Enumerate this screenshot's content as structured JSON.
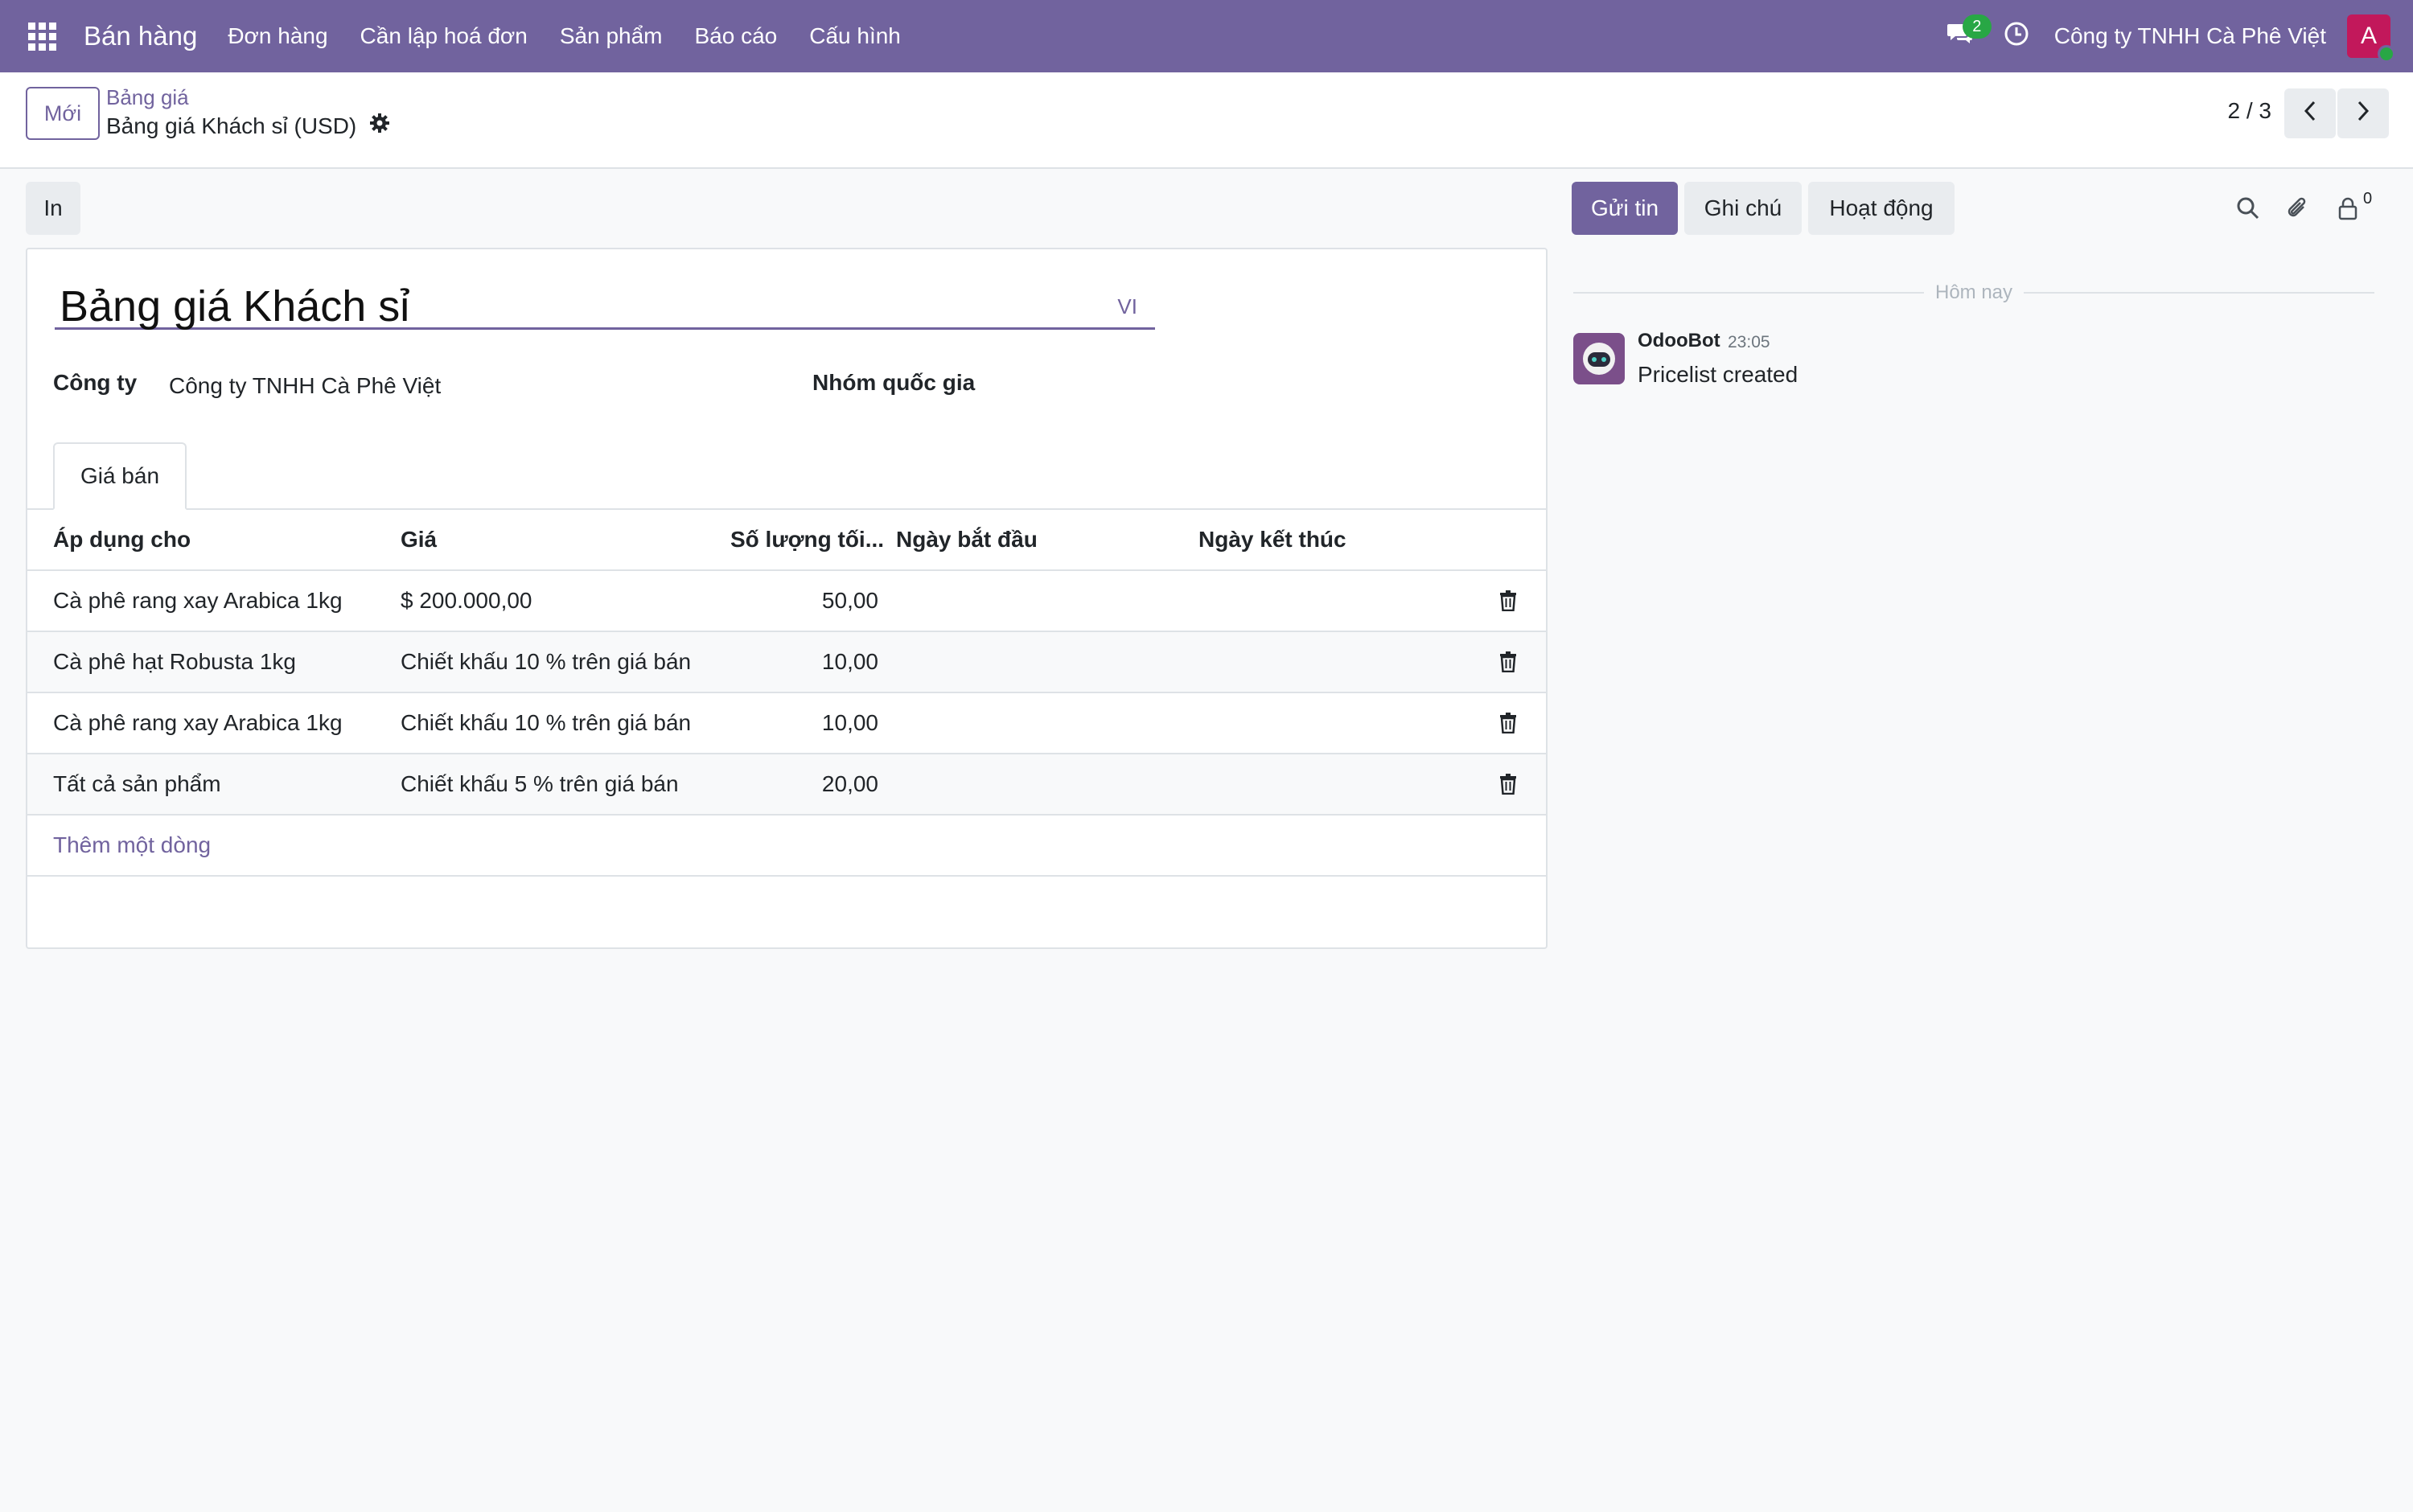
{
  "navbar": {
    "app_name": "Bán hàng",
    "menu": [
      "Đơn hàng",
      "Cần lập hoá đơn",
      "Sản phẩm",
      "Báo cáo",
      "Cấu hình"
    ],
    "messages_count": "2",
    "company": "Công ty TNHH Cà Phê Việt",
    "user_initial": "A"
  },
  "control_panel": {
    "new_label": "Mới",
    "breadcrumb_parent": "Bảng giá",
    "breadcrumb_current": "Bảng giá Khách sỉ (USD)",
    "pager": "2 / 3"
  },
  "form": {
    "print_label": "In",
    "title": "Bảng giá Khách sỉ",
    "lang": "VI",
    "company_label": "Công ty",
    "company_value": "Công ty TNHH Cà Phê Việt",
    "country_group_label": "Nhóm quốc gia",
    "tab_label": "Giá bán",
    "columns": [
      "Áp dụng cho",
      "Giá",
      "Số lượng tối...",
      "Ngày bắt đầu",
      "Ngày kết thúc"
    ],
    "rows": [
      {
        "apply": "Cà phê rang xay Arabica 1kg",
        "price": "$ 200.000,00",
        "qty": "50,00",
        "start": "",
        "end": ""
      },
      {
        "apply": "Cà phê hạt Robusta 1kg",
        "price": "Chiết khấu 10 % trên giá bán",
        "qty": "10,00",
        "start": "",
        "end": ""
      },
      {
        "apply": "Cà phê rang xay Arabica 1kg",
        "price": "Chiết khấu 10 % trên giá bán",
        "qty": "10,00",
        "start": "",
        "end": ""
      },
      {
        "apply": "Tất cả sản phẩm",
        "price": "Chiết khấu 5 % trên giá bán",
        "qty": "20,00",
        "start": "",
        "end": ""
      }
    ],
    "add_line": "Thêm một dòng"
  },
  "chatter": {
    "send_label": "Gửi tin",
    "note_label": "Ghi chú",
    "activity_label": "Hoạt động",
    "followers_count": "0",
    "day_separator": "Hôm nay",
    "messages": [
      {
        "author": "OdooBot",
        "time": "23:05",
        "body": "Pricelist created"
      }
    ]
  },
  "colors": {
    "brand": "#71639e",
    "badge": "#28a745",
    "avatar": "#c2185b"
  }
}
